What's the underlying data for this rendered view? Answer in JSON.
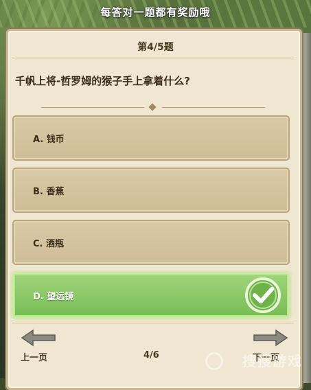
{
  "header": {
    "title": "每答对一题都有奖励哦"
  },
  "quiz": {
    "progress": "第4/5题",
    "question": "千帆上将-哲罗姆的猴子手上拿着什么?",
    "options": [
      {
        "label": "A. 钱币",
        "state": "normal"
      },
      {
        "label": "B. 香蕉",
        "state": "normal"
      },
      {
        "label": "C. 酒瓶",
        "state": "normal"
      },
      {
        "label": "D. 望远镜",
        "state": "correct"
      }
    ],
    "correct_icon": "check-mark-icon"
  },
  "footer": {
    "prev_label": "上一页",
    "next_label": "下一页",
    "page_indicator": "4/6",
    "prev_icon": "arrow-left-icon",
    "next_icon": "arrow-right-icon"
  },
  "watermark": {
    "text": "搜搜游戏"
  },
  "colors": {
    "panel": "#efe7d1",
    "option": "#d4c39e",
    "correct": "#8bc96a",
    "text": "#3d2e1c"
  }
}
